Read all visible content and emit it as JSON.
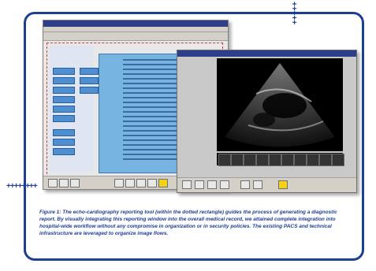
{
  "figure": {
    "caption": "Figure 1: The echo-cardiography reporting tool (within the dotted rectangle) guides the process of generating a diagnostic report. By visually integrating this reporting window into the overall medical record, we attained complete integration into hospital-wide workflow without any compromise in organization or in security policies. The existing PACS and technical infrastructure are leveraged to organize image flows."
  },
  "decor": {
    "cross_top": "+++++",
    "cross_left": "++++++++"
  },
  "icons": {
    "screenshot_reporting": "reporting-window-screenshot",
    "screenshot_echo": "echocardiography-viewer-screenshot"
  },
  "colors": {
    "frame_border": "#1d3f93",
    "caption_text": "#1d3f93",
    "report_panel": "#78b4e0",
    "dotted_rect": "#c04040"
  }
}
